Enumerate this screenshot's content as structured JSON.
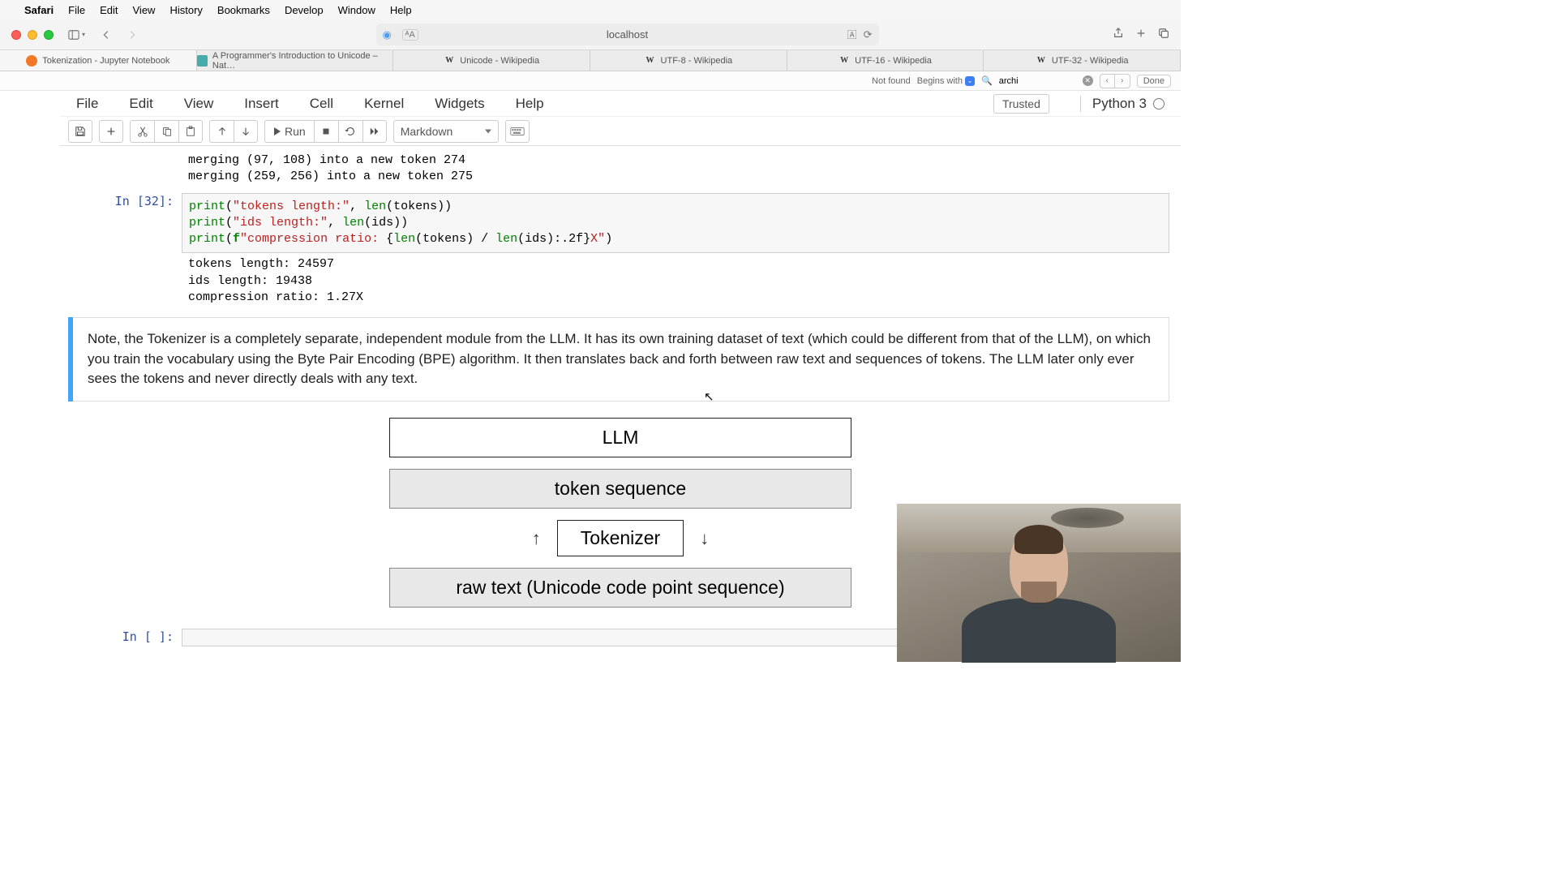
{
  "macos_menu": {
    "app": "Safari",
    "items": [
      "File",
      "Edit",
      "View",
      "History",
      "Bookmarks",
      "Develop",
      "Window",
      "Help"
    ]
  },
  "addressbar": {
    "host": "localhost"
  },
  "safari_tabs": [
    {
      "label": "Tokenization - Jupyter Notebook",
      "favicon": "jupyter",
      "active": true
    },
    {
      "label": "A Programmer's Introduction to Unicode – Nat…",
      "favicon": "nat"
    },
    {
      "label": "Unicode - Wikipedia",
      "favicon": "wiki"
    },
    {
      "label": "UTF-8 - Wikipedia",
      "favicon": "wiki"
    },
    {
      "label": "UTF-16 - Wikipedia",
      "favicon": "wiki"
    },
    {
      "label": "UTF-32 - Wikipedia",
      "favicon": "wiki"
    }
  ],
  "findbar": {
    "notfound": "Not found",
    "begins": "Begins with",
    "query": "archi",
    "done": "Done"
  },
  "jupyter_menu": [
    "File",
    "Edit",
    "View",
    "Insert",
    "Cell",
    "Kernel",
    "Widgets",
    "Help"
  ],
  "trusted": "Trusted",
  "kernel_name": "Python 3",
  "run_label": "Run",
  "celltype": "Markdown",
  "output_merge": "merging (97, 108) into a new token 274\nmerging (259, 256) into a new token 275",
  "cell32": {
    "prompt": "In [32]:",
    "code_plain": "print(\"tokens length:\", len(tokens))\nprint(\"ids length:\", len(ids))\nprint(f\"compression ratio: {len(tokens) / len(ids):.2f}X\")",
    "output": "tokens length: 24597\nids length: 19438\ncompression ratio: 1.27X"
  },
  "md_text": "Note, the Tokenizer is a completely separate, independent module from the LLM. It has its own training dataset of text (which could be different from that of the LLM), on which you train the vocabulary using the Byte Pair Encoding (BPE) algorithm. It then translates back and forth between raw text and sequences of tokens. The LLM later only ever sees the tokens and never directly deals with any text.",
  "diagram": {
    "llm": "LLM",
    "tokseq": "token sequence",
    "tokenizer": "Tokenizer",
    "raw": "raw text (Unicode code point sequence)"
  },
  "empty_prompt": "In [ ]:"
}
